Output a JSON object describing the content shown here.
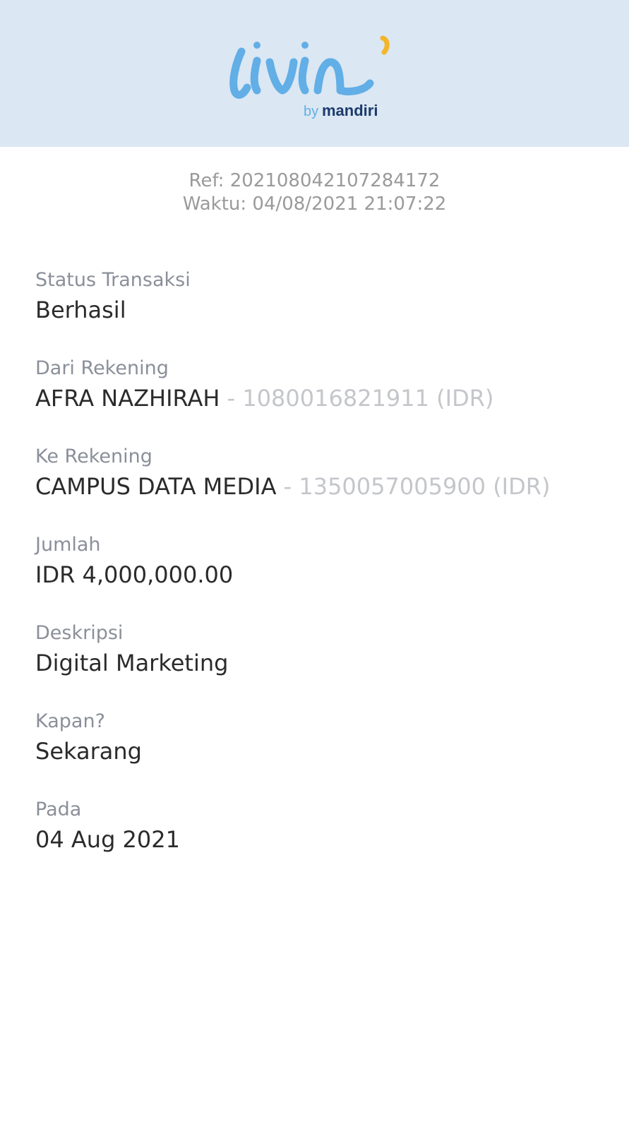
{
  "brand": {
    "logo_text": "livin'",
    "by_text": "by",
    "bank_name": "mandiri",
    "colors": {
      "script": "#62aee6",
      "accent": "#f3b62a",
      "bank": "#1c3b6b",
      "header_bg": "#dbe7f3"
    }
  },
  "receipt": {
    "ref": "Ref: 202108042107284172",
    "time": "Waktu: 04/08/2021 21:07:22"
  },
  "fields": {
    "status": {
      "label": "Status Transaksi",
      "value": "Berhasil"
    },
    "from": {
      "label": "Dari Rekening",
      "name": "AFRA NAZHIRAH",
      "account": "- 1080016821911 (IDR)"
    },
    "to": {
      "label": "Ke Rekening",
      "name": "CAMPUS DATA MEDIA",
      "account": "- 1350057005900 (IDR)"
    },
    "amount": {
      "label": "Jumlah",
      "value": "IDR 4,000,000.00"
    },
    "description": {
      "label": "Deskripsi",
      "value": "Digital Marketing"
    },
    "when": {
      "label": "Kapan?",
      "value": "Sekarang"
    },
    "date": {
      "label": "Pada",
      "value": "04 Aug 2021"
    }
  }
}
